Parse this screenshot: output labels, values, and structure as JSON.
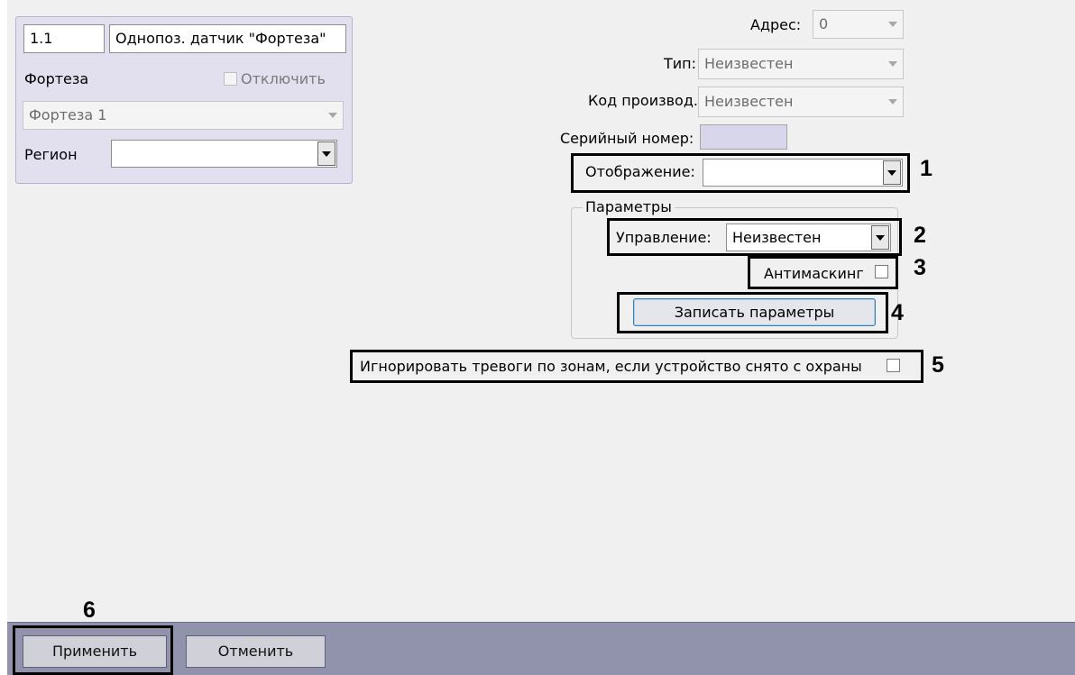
{
  "device": {
    "number": "1.1",
    "name": "Однопоз. датчик \"Фортеза\"",
    "parent_label": "Фортеза",
    "disable_label": "Отключить",
    "parent_value": "Фортеза 1",
    "region_label": "Регион",
    "region_value": ""
  },
  "info": {
    "address_label": "Адрес:",
    "address_value": "0",
    "type_label": "Тип:",
    "type_value": "Неизвестен",
    "manufacturer_label": "Код производ.:",
    "manufacturer_value": "Неизвестен",
    "serial_label": "Серийный номер:",
    "serial_value": "",
    "display_label": "Отображение:",
    "display_value": ""
  },
  "params": {
    "group_label": "Параметры",
    "control_label": "Управление:",
    "control_value": "Неизвестен",
    "antimasking_label": "Антимаскинг",
    "antimasking_checked": false,
    "write_button": "Записать параметры"
  },
  "ignore_alarms": {
    "label": "Игнорировать тревоги по зонам, если устройство снято с охраны",
    "checked": false
  },
  "callouts": [
    "1",
    "2",
    "3",
    "4",
    "5",
    "6"
  ],
  "footer": {
    "apply_button": "Применить",
    "cancel_button": "Отменить"
  }
}
